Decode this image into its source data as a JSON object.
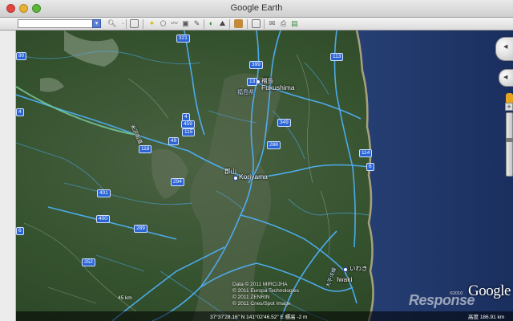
{
  "window": {
    "title": "Google Earth"
  },
  "toolbar": {
    "search_value": "",
    "buttons": [
      "magnifier-icon",
      "dot-icon",
      "sidebar-icon",
      "placemark-icon",
      "polygon-icon",
      "path-icon",
      "overlay-icon",
      "tour-icon",
      "sun-icon",
      "sky-icon",
      "ruler-icon",
      "email-icon",
      "print-icon",
      "map-icon"
    ]
  },
  "map": {
    "cities": [
      {
        "jp": "福島",
        "name": "Fukushima"
      },
      {
        "jp": "福島県",
        "name": ""
      },
      {
        "jp": "郡山",
        "name": "Koriyama"
      },
      {
        "jp": "いわき",
        "name": "Iwaki"
      }
    ],
    "roads": [
      "米沢街道",
      "大平洋線"
    ],
    "routes": [
      "321",
      "399",
      "13",
      "113",
      "459",
      "115",
      "4",
      "49",
      "118",
      "294",
      "288",
      "401",
      "400",
      "289",
      "352",
      "90",
      "114",
      "6",
      "349",
      "4",
      "6"
    ],
    "credits": [
      "Data © 2011 MIRC/JHA",
      "© 2011 Europa Technologies",
      "© 2011 ZENRIN",
      "© 2011 Cnes/Spot Image"
    ],
    "scale": "45 km",
    "coordinates": "37°37'28.16\" N 141°02'46.52\" E 標高   -2 m",
    "altitude_label": "高度",
    "altitude_value": "186.91 km",
    "logo": "Google",
    "copyright": "©2010",
    "watermark": "Response"
  },
  "colors": {
    "roads": "#4fb3ff",
    "ocean": "#1d3567",
    "land": "#3b5a33"
  }
}
